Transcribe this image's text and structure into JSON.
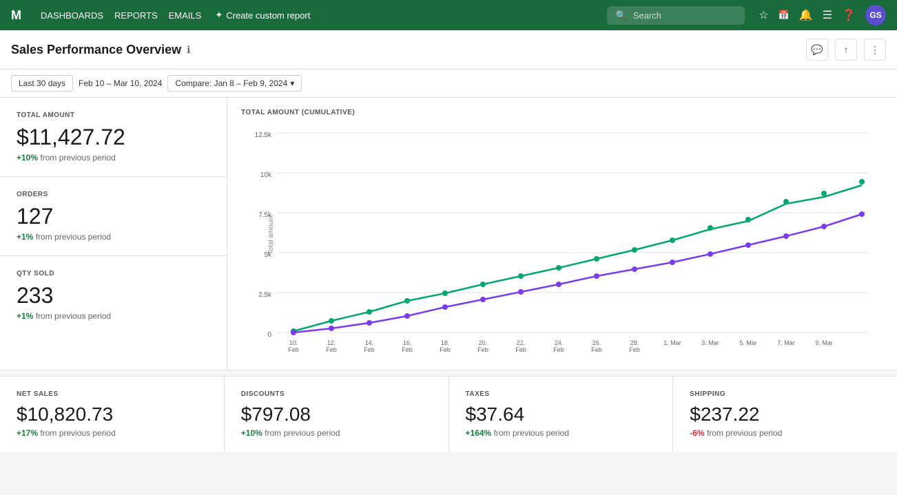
{
  "nav": {
    "logo": "M",
    "links": [
      "DASHBOARDS",
      "REPORTS",
      "EMAILS"
    ],
    "create_label": "Create custom report",
    "search_placeholder": "Search",
    "avatar_initials": "GS"
  },
  "header": {
    "title": "Sales Performance Overview",
    "info_icon": "ℹ"
  },
  "filter": {
    "period_btn": "Last 30 days",
    "date_range": "Feb 10 – Mar 10, 2024",
    "compare_label": "Compare: Jan 8 – Feb 9, 2024"
  },
  "metrics": {
    "total_amount": {
      "label": "TOTAL AMOUNT",
      "value": "$11,427.72",
      "change_pct": "+10%",
      "change_text": "from previous period"
    },
    "orders": {
      "label": "ORDERS",
      "value": "127",
      "change_pct": "+1%",
      "change_text": "from previous period"
    },
    "qty_sold": {
      "label": "QTY SOLD",
      "value": "233",
      "change_pct": "+1%",
      "change_text": "from previous period"
    }
  },
  "chart": {
    "title": "TOTAL AMOUNT (CUMULATIVE)",
    "y_axis_labels": [
      "0",
      "2.5k",
      "5k",
      "7.5k",
      "10k",
      "12.5k"
    ],
    "x_axis_labels": [
      "10.\nFeb",
      "12.\nFeb",
      "14.\nFeb",
      "16.\nFeb",
      "18.\nFeb",
      "20.\nFeb",
      "22.\nFeb",
      "24.\nFeb",
      "26.\nFeb",
      "28.\nFeb",
      "1. Mar",
      "3. Mar",
      "5. Mar",
      "7. Mar",
      "9. Mar"
    ],
    "y_axis_title": "Total amount"
  },
  "bottom": {
    "net_sales": {
      "label": "NET SALES",
      "value": "$10,820.73",
      "change_pct": "+17%",
      "change_text": "from previous period",
      "positive": true
    },
    "discounts": {
      "label": "DISCOUNTS",
      "value": "$797.08",
      "change_pct": "+10%",
      "change_text": "from previous period",
      "positive": true
    },
    "taxes": {
      "label": "TAXES",
      "value": "$37.64",
      "change_pct": "+164%",
      "change_text": "from previous period",
      "positive": true
    },
    "shipping": {
      "label": "SHIPPING",
      "value": "$237.22",
      "change_pct": "-6%",
      "change_text": "from previous period",
      "positive": false
    }
  }
}
